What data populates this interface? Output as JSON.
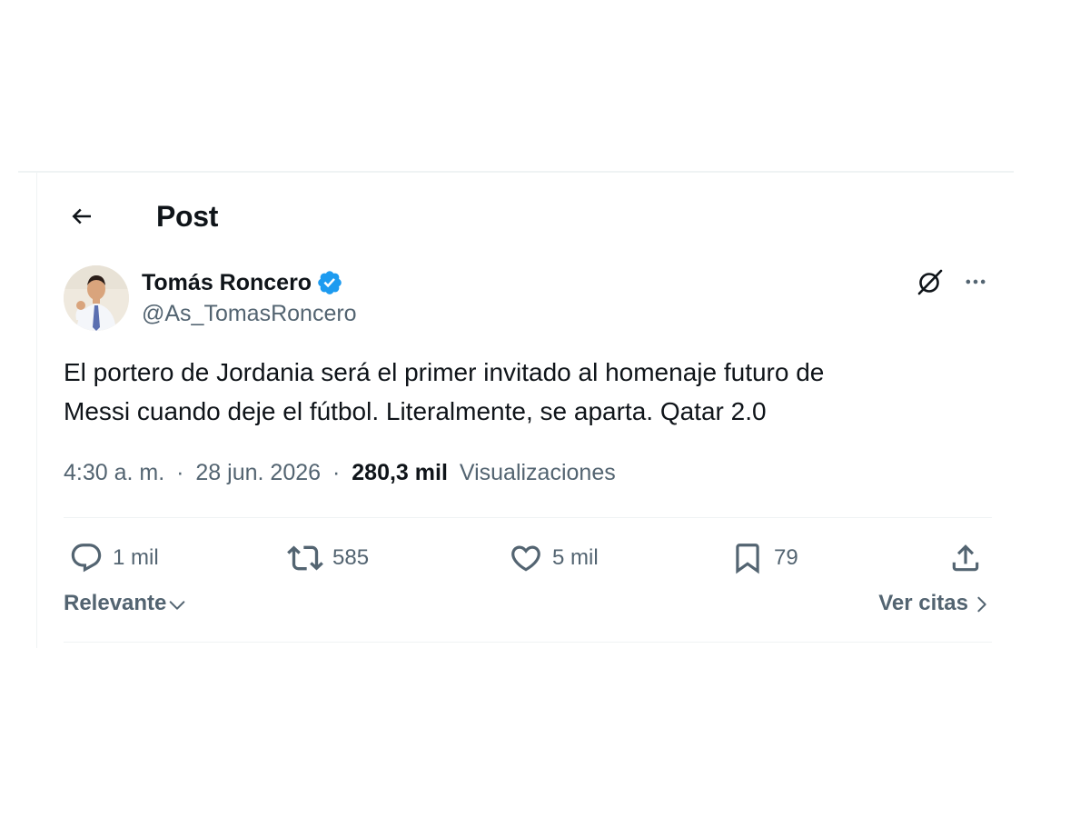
{
  "header": {
    "title": "Post",
    "back_icon": "arrow-left-icon"
  },
  "author": {
    "display_name": "Tomás Roncero",
    "handle": "@As_TomasRoncero",
    "verified": true,
    "verified_color": "#1d9bf0"
  },
  "tweet": {
    "text_line1": "El portero de Jordania será el primer invitado al homenaje futuro de",
    "text_line2": "Messi cuando deje el fútbol. Literalmente, se aparta. Qatar 2.0",
    "time": "4:30 a. m.",
    "date": "28 jun. 2026",
    "views_count": "280,3 mil",
    "views_label": "Visualizaciones",
    "separator": "·"
  },
  "actions": {
    "replies": "1 mil",
    "reposts": "585",
    "likes": "5 mil",
    "bookmarks": "79"
  },
  "sort": {
    "label": "Relevante"
  },
  "quotes": {
    "label": "Ver citas"
  },
  "colors": {
    "text_primary": "#0f1419",
    "text_secondary": "#536471",
    "divider": "#eff3f4",
    "accent": "#1d9bf0"
  }
}
